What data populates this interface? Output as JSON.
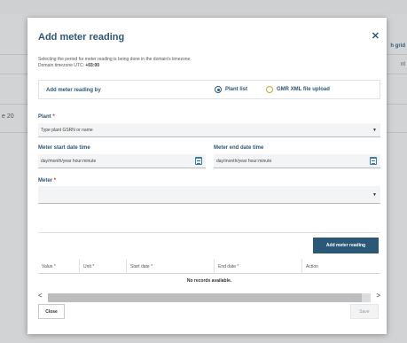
{
  "background": {
    "left_fragment": "e 20",
    "right_fragments": [
      "h grid",
      "nt"
    ]
  },
  "modal": {
    "title": "Add meter reading",
    "close_icon": "close-icon",
    "info_line1": "Selecting the period for meter reading is being done in the domain's timezone.",
    "info_line2_prefix": "Domain timezone UTC: ",
    "info_line2_value": "+03:00",
    "reading_by": {
      "label": "Add meter reading by",
      "options": [
        {
          "label": "Plant list",
          "selected": true
        },
        {
          "label": "GMR XML file upload",
          "selected": false
        }
      ]
    },
    "plant": {
      "label": "Plant",
      "required_mark": "*",
      "placeholder": "Type plant GSRN or name"
    },
    "start_date": {
      "label": "Meter start date time",
      "placeholder": "day/month/year hour:minute"
    },
    "end_date": {
      "label": "Meter end date time",
      "placeholder": "day/month/year hour:minute"
    },
    "meter": {
      "label": "Meter",
      "required_mark": "*",
      "value": ""
    },
    "add_button": "Add meter reading",
    "table": {
      "columns": [
        {
          "label": "Value",
          "required": "*"
        },
        {
          "label": "Unit",
          "required": "*"
        },
        {
          "label": "Start date",
          "required": "*"
        },
        {
          "label": "End date",
          "required": "*"
        },
        {
          "label": "Action",
          "required": ""
        }
      ],
      "empty_text": "No records available."
    },
    "scroll_left": "<",
    "scroll_right": ">",
    "close_button": "Close",
    "save_button": "Save"
  },
  "colors": {
    "accent": "#2c5877",
    "required": "#c0392b",
    "radio_unselected": "#b6b038"
  }
}
